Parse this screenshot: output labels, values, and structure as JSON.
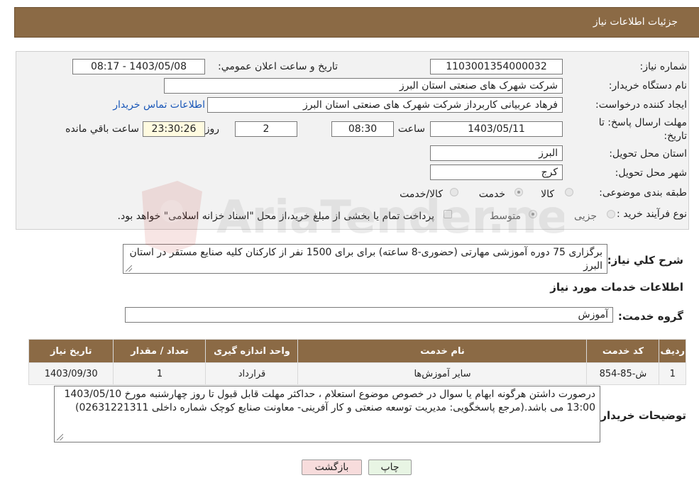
{
  "header": {
    "title": "جزئیات اطلاعات نیاز"
  },
  "fields": {
    "need_number_label": "شماره نیاز:",
    "need_number": "1103001354000032",
    "announce_label": "تاریخ و ساعت اعلان عمومي:",
    "announce_value": "1403/05/08 - 08:17",
    "buyer_org_label": "نام دستگاه خريدار:",
    "buyer_org": "شرکت شهرک های صنعتی استان البرز",
    "creator_label": "ايجاد کننده درخواست:",
    "creator": "فرهاد عربیانی کاربرداز شرکت شهرک های صنعتی استان البرز",
    "contact_link": "اطلاعات تماس خريدار",
    "deadline_label": "مهلت ارسال پاسخ: تا تاريخ:",
    "deadline_date": "1403/05/11",
    "time_label": "ساعت",
    "deadline_time": "08:30",
    "days_value": "2",
    "days_label": "روز و",
    "remaining_time": "23:30:26",
    "remaining_label": "ساعت باقي مانده",
    "province_label": "استان محل تحويل:",
    "province": "البرز",
    "city_label": "شهر محل تحويل:",
    "city": "کرج",
    "category_label": "طبقه بندی موضوعی:",
    "category_options": [
      "کالا",
      "خدمت",
      "کالا/خدمت"
    ],
    "category_selected": "خدمت",
    "process_label": "نوع فرآیند خرید :",
    "process_options": [
      "جزیی",
      "متوسط"
    ],
    "process_note": "پرداخت تمام يا بخشی از مبلغ خريد،از محل \"اسناد خزانه اسلامی\" خواهد بود."
  },
  "summary": {
    "label": "شرح كلي نياز:",
    "text": "برگزاری 75 دوره آموزشی مهارتی (حضوری-8 ساعته) برای  برای  1500 نفر از کارکنان کلیه صنایع مستقر در استان البرز"
  },
  "services_section": {
    "title": "اطلاعات خدمات مورد نياز",
    "group_label": "گروه خدمت:",
    "group_value": "آموزش"
  },
  "table": {
    "headers": [
      "رديف",
      "کد خدمت",
      "نام خدمت",
      "واحد اندازه گيری",
      "تعداد / مقدار",
      "تاريخ نياز"
    ],
    "rows": [
      [
        "1",
        "ش-85-854",
        "سایر آموزش‌ها",
        "قرارداد",
        "1",
        "1403/09/30"
      ]
    ]
  },
  "buyer_notes": {
    "label": "توضيحات خريدار:",
    "text": "درصورت داشتن هرگونه ابهام یا سوال در خصوص موضوع استعلام ، حداکثر مهلت قابل قبول تا روز چهارشنبه مورخ 1403/05/10 13:00  می باشد.(مرجع پاسخگویی: مدیریت توسعه صنعتی و کار آفرینی- معاونت صنایع کوچک شماره داخلی 02631221311)"
  },
  "buttons": {
    "print": "چاپ",
    "back": "بازگشت"
  },
  "watermark": {
    "text": "AriaTender.net"
  },
  "colors": {
    "header": "#8b6a45",
    "link": "#1a57b8",
    "back_button": "#f7dcdc",
    "print_button": "#e8f5e4"
  }
}
